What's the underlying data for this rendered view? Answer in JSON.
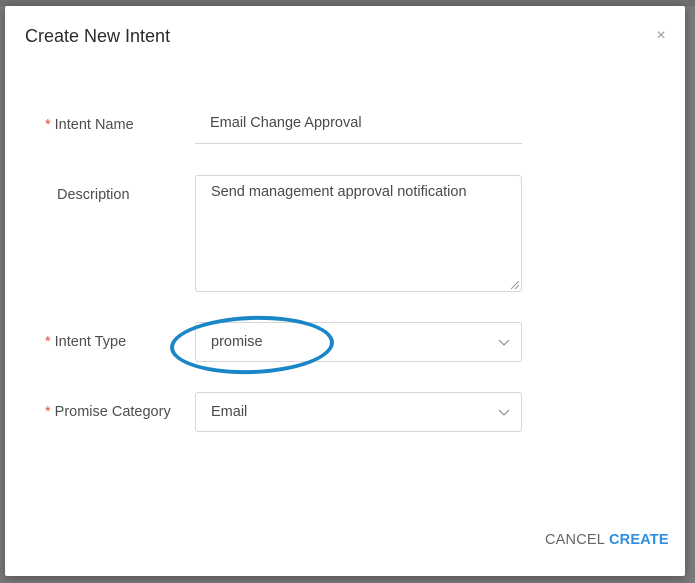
{
  "dialog": {
    "title": "Create New Intent",
    "close_glyph": "×"
  },
  "form": {
    "required_marker": "*",
    "intent_name": {
      "label": "Intent Name",
      "value": "Email Change Approval",
      "required": true
    },
    "description": {
      "label": "Description",
      "value": "Send management approval notification",
      "required": false
    },
    "intent_type": {
      "label": "Intent Type",
      "value": "promise",
      "required": true
    },
    "promise_category": {
      "label": "Promise Category",
      "value": "Email",
      "required": true
    }
  },
  "actions": {
    "cancel_label": "CANCEL",
    "create_label": "CREATE"
  },
  "colors": {
    "accent": "#2f8ee0",
    "required": "#e0503f",
    "annotation": "#1a86c7"
  }
}
